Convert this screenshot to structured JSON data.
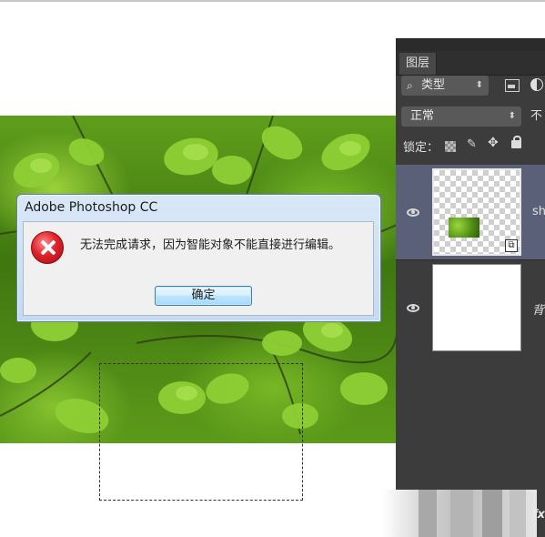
{
  "dialog": {
    "title": "Adobe Photoshop CC",
    "message": "无法完成请求，因为智能对象不能直接进行编辑。",
    "ok_label": "确定",
    "icon": "error-icon"
  },
  "layers_panel": {
    "tab_label": "图层",
    "filter": {
      "icon": "search-icon",
      "label": "类型"
    },
    "blend_mode": "正常",
    "opacity_label_partial": "不",
    "lock_label": "锁定：",
    "layers": [
      {
        "name_partial": "sh",
        "type": "smart-object",
        "visible": true,
        "selected": true
      },
      {
        "name_partial": "背",
        "type": "background",
        "visible": true,
        "selected": false
      }
    ],
    "fx_label": "fx"
  }
}
